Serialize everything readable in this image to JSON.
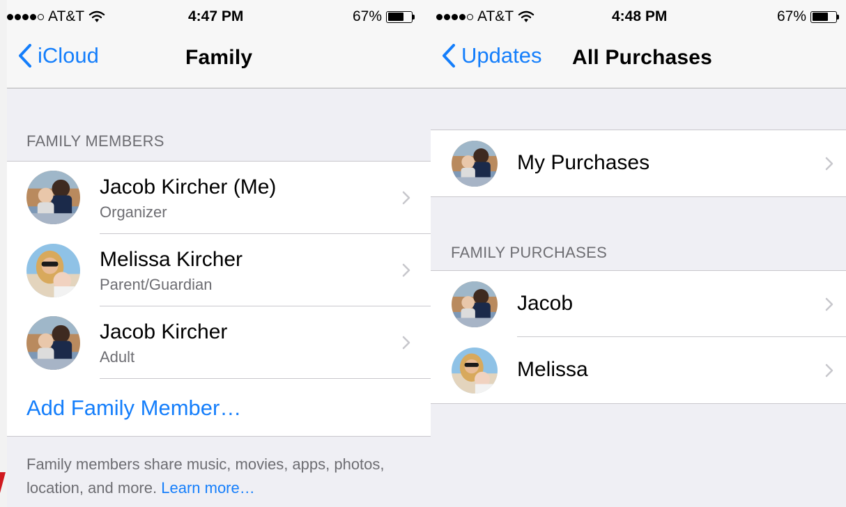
{
  "colors": {
    "accent": "#147efb",
    "background": "#efeff4",
    "nav_bar": "#f7f7f7",
    "secondary_text": "#6d6d72"
  },
  "left_screen": {
    "status_bar": {
      "carrier": "AT&T",
      "time": "4:47 PM",
      "battery": "67%",
      "battery_level": 0.67,
      "signal_bars_filled": 4,
      "signal_bars_total": 5
    },
    "nav": {
      "back_label": "iCloud",
      "title": "Family"
    },
    "section_header": "FAMILY MEMBERS",
    "members": [
      {
        "name": "Jacob Kircher (Me)",
        "role": "Organizer",
        "avatar": "jacob-avatar"
      },
      {
        "name": "Melissa Kircher",
        "role": "Parent/Guardian",
        "avatar": "melissa-avatar"
      },
      {
        "name": "Jacob Kircher",
        "role": "Adult",
        "avatar": "jacob-avatar"
      }
    ],
    "add_member": "Add Family Member…",
    "footer": {
      "text": "Family members share music, movies, apps, photos, location, and more.",
      "link": "Learn more…"
    }
  },
  "right_screen": {
    "status_bar": {
      "carrier": "AT&T",
      "time": "4:48 PM",
      "battery": "67%",
      "battery_level": 0.67,
      "signal_bars_filled": 4,
      "signal_bars_total": 5
    },
    "nav": {
      "back_label": "Updates",
      "title": "All Purchases"
    },
    "my_purchases": {
      "label": "My Purchases",
      "avatar": "jacob-avatar"
    },
    "section_header": "FAMILY PURCHASES",
    "family_purchases": [
      {
        "name": "Jacob",
        "avatar": "jacob-avatar"
      },
      {
        "name": "Melissa",
        "avatar": "melissa-avatar"
      }
    ]
  }
}
